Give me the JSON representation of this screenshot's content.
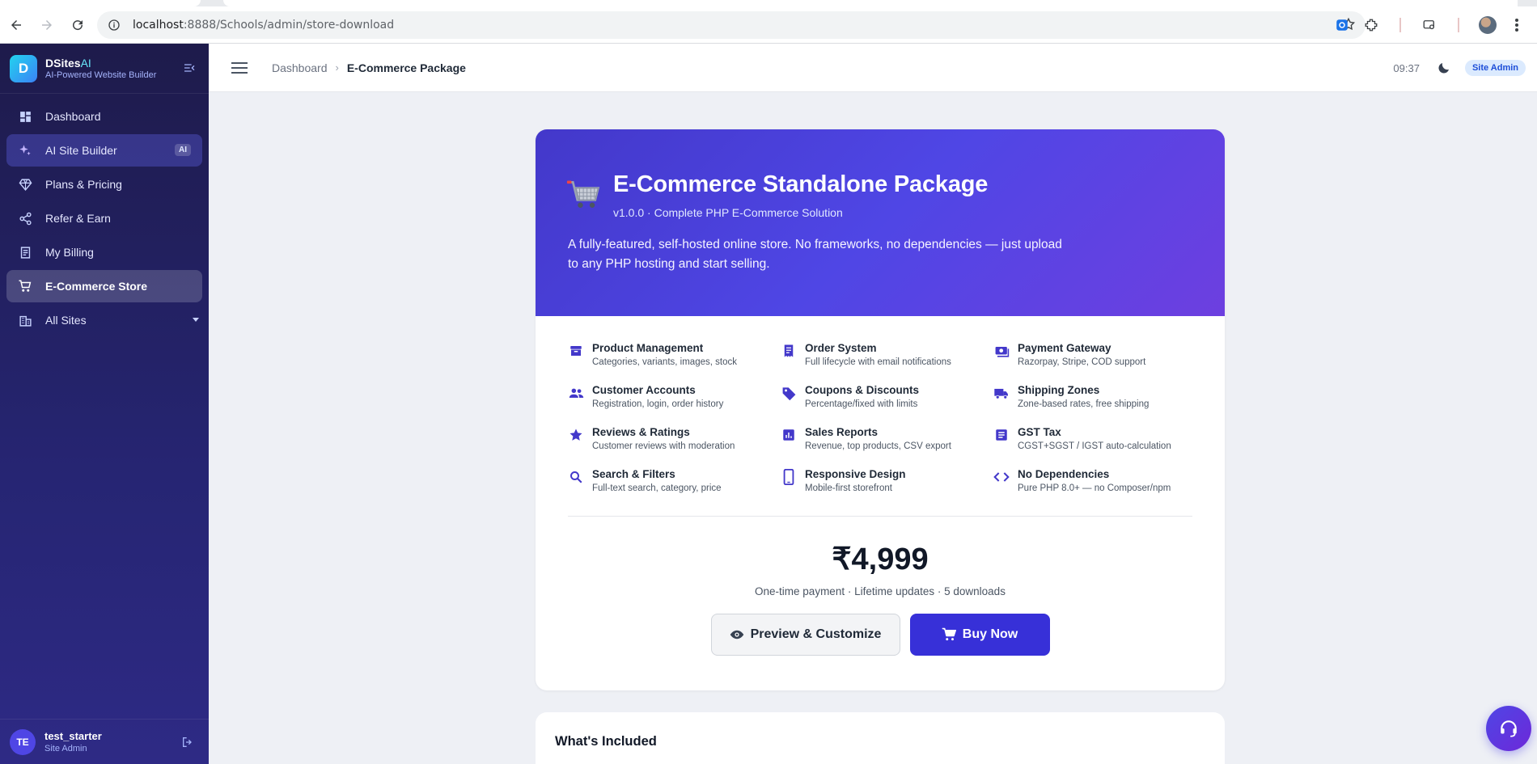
{
  "browser": {
    "url_host": "localhost",
    "url_path": ":8888/Schools/admin/store-download"
  },
  "sidebar": {
    "brand_name": "DSites",
    "brand_ai": "AI",
    "brand_logo_letter": "D",
    "brand_subtitle": "AI-Powered Website Builder",
    "items": [
      {
        "label": "Dashboard",
        "icon": "dashboard-icon"
      },
      {
        "label": "AI Site Builder",
        "icon": "sparkle-icon",
        "badge": "AI"
      },
      {
        "label": "Plans & Pricing",
        "icon": "diamond-icon"
      },
      {
        "label": "Refer & Earn",
        "icon": "share-icon"
      },
      {
        "label": "My Billing",
        "icon": "receipt-icon"
      },
      {
        "label": "E-Commerce Store",
        "icon": "cart-icon"
      },
      {
        "label": "All Sites",
        "icon": "building-icon"
      }
    ],
    "user": {
      "initials": "TE",
      "name": "test_starter",
      "role": "Site Admin"
    }
  },
  "topbar": {
    "breadcrumb_parent": "Dashboard",
    "breadcrumb_separator": "›",
    "breadcrumb_current": "E-Commerce Package",
    "clock": "09:37",
    "role_badge": "Site Admin"
  },
  "package": {
    "title": "E-Commerce Standalone Package",
    "subtitle": "v1.0.0 · Complete PHP E-Commerce Solution",
    "description": "A fully-featured, self-hosted online store. No frameworks, no dependencies — just upload to any PHP hosting and start selling.",
    "features": [
      {
        "title": "Product Management",
        "desc": "Categories, variants, images, stock",
        "icon": "archive-icon"
      },
      {
        "title": "Order System",
        "desc": "Full lifecycle with email notifications",
        "icon": "receipt-icon"
      },
      {
        "title": "Payment Gateway",
        "desc": "Razorpay, Stripe, COD support",
        "icon": "payment-icon"
      },
      {
        "title": "Customer Accounts",
        "desc": "Registration, login, order history",
        "icon": "people-icon"
      },
      {
        "title": "Coupons & Discounts",
        "desc": "Percentage/fixed with limits",
        "icon": "tag-icon"
      },
      {
        "title": "Shipping Zones",
        "desc": "Zone-based rates, free shipping",
        "icon": "truck-icon"
      },
      {
        "title": "Reviews & Ratings",
        "desc": "Customer reviews with moderation",
        "icon": "star-icon"
      },
      {
        "title": "Sales Reports",
        "desc": "Revenue, top products, CSV export",
        "icon": "chart-icon"
      },
      {
        "title": "GST Tax",
        "desc": "CGST+SGST / IGST auto-calculation",
        "icon": "document-icon"
      },
      {
        "title": "Search & Filters",
        "desc": "Full-text search, category, price",
        "icon": "search-icon"
      },
      {
        "title": "Responsive Design",
        "desc": "Mobile-first storefront",
        "icon": "phone-icon"
      },
      {
        "title": "No Dependencies",
        "desc": "Pure PHP 8.0+ — no Composer/npm",
        "icon": "code-icon"
      }
    ],
    "price": "₹4,999",
    "price_note": "One-time payment · Lifetime updates · 5 downloads",
    "preview_label": "Preview & Customize",
    "buy_label": "Buy Now"
  },
  "included": {
    "title": "What's Included"
  },
  "colors": {
    "accent": "#4f46e5",
    "sidebar_bg": "#1e1b4b",
    "buy_button": "#3730d8"
  }
}
